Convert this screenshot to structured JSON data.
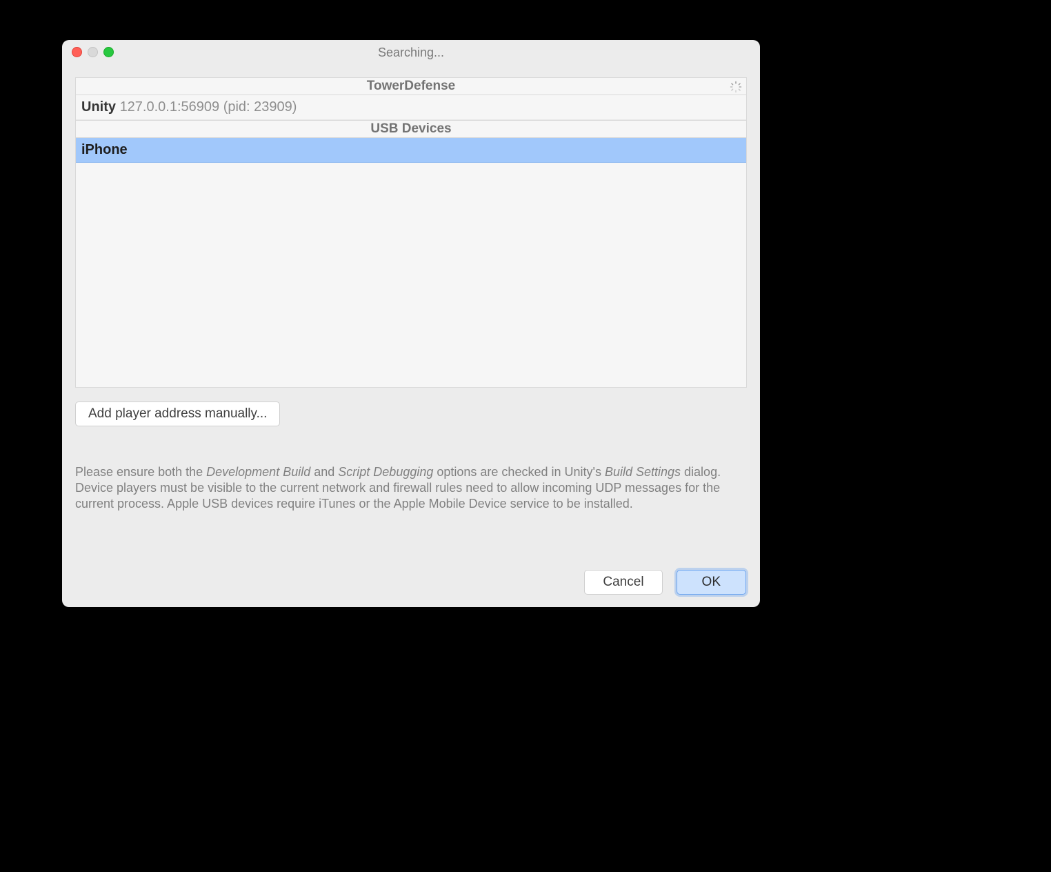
{
  "title": "Searching...",
  "sections": {
    "project": {
      "header": "TowerDefense",
      "row_process": "Unity",
      "row_address": "127.0.0.1:56909 (pid: 23909)"
    },
    "usb": {
      "header": "USB Devices",
      "row_device": "iPhone"
    }
  },
  "add_button": "Add player address manually...",
  "help": {
    "pre1": "Please ensure both the ",
    "em1": "Development Build",
    "mid1": "  and ",
    "em2": "Script Debugging",
    "mid2": "  options are checked in Unity's ",
    "em3": "Build Settings",
    "post": " dialog. Device players must be visible to the current network and firewall rules need to allow incoming UDP messages for the current process. Apple USB devices require iTunes or the Apple Mobile Device service to be installed."
  },
  "buttons": {
    "cancel": "Cancel",
    "ok": "OK"
  }
}
